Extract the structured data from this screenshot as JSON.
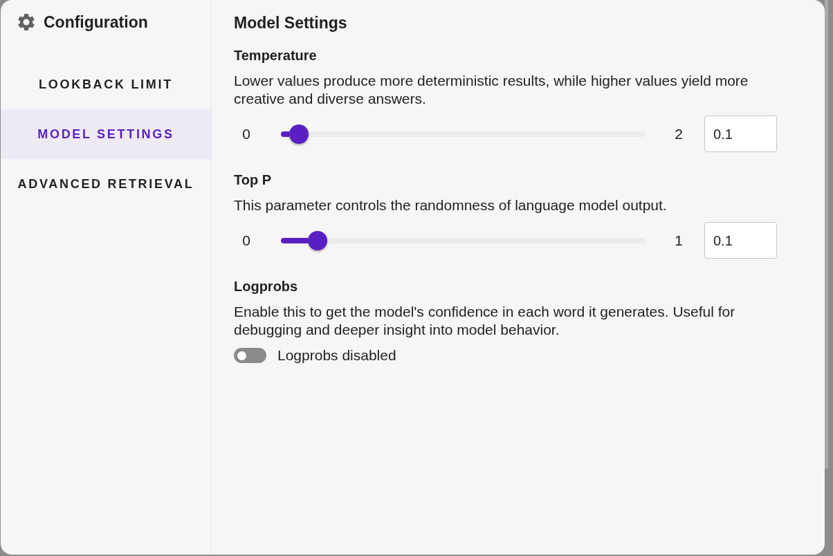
{
  "sidebar": {
    "title": "Configuration",
    "items": [
      {
        "label": "LOOKBACK LIMIT",
        "selected": false
      },
      {
        "label": "MODEL SETTINGS",
        "selected": true
      },
      {
        "label": "ADVANCED RETRIEVAL",
        "selected": false
      }
    ]
  },
  "content": {
    "title": "Model Settings",
    "settings": [
      {
        "kind": "slider",
        "label": "Temperature",
        "description": "Lower values produce more deterministic results, while higher values yield more creative and diverse answers.",
        "min_label": "0",
        "max_label": "2",
        "level": 0.05,
        "value": "0.1"
      },
      {
        "kind": "slider",
        "label": "Top P",
        "description": "This parameter controls the randomness of language model output.",
        "min_label": "0",
        "max_label": "1",
        "level": 0.1,
        "value": "0.1"
      },
      {
        "kind": "toggle",
        "label": "Logprobs",
        "description": "Enable this to get the model's confidence in each word it generates. Useful for debugging and deeper insight into model behavior.",
        "on": false,
        "toggle_label": "Logprobs disabled"
      }
    ]
  }
}
